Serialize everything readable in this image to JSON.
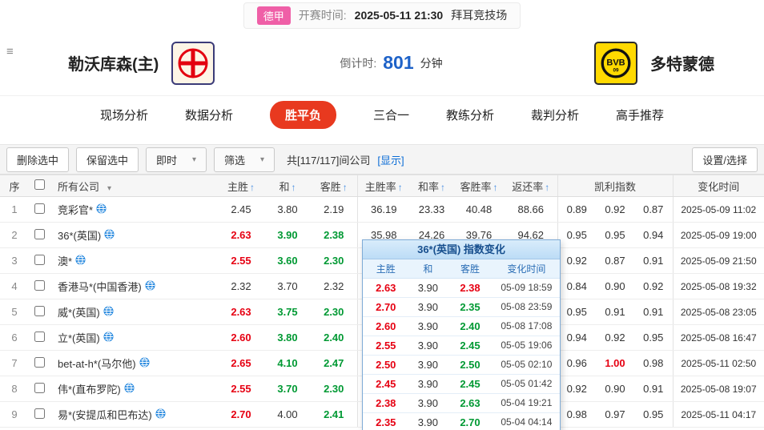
{
  "top_bar": {
    "league": "德甲",
    "kickoff_label": "开赛时间:",
    "kickoff_time": "2025-05-11 21:30",
    "venue": "拜耳竞技场"
  },
  "header": {
    "home_team": "勒沃库森(主)",
    "away_team": "多特蒙德",
    "countdown_label": "倒计时:",
    "countdown_value": "801",
    "countdown_unit": "分钟",
    "away_logo_text": "BVB",
    "away_logo_sub": "09"
  },
  "nav": {
    "tabs": [
      {
        "label": "现场分析",
        "active": false
      },
      {
        "label": "数据分析",
        "active": false
      },
      {
        "label": "胜平负",
        "active": true
      },
      {
        "label": "三合一",
        "active": false
      },
      {
        "label": "教练分析",
        "active": false
      },
      {
        "label": "裁判分析",
        "active": false
      },
      {
        "label": "高手推荐",
        "active": false
      }
    ]
  },
  "toolbar": {
    "delete_btn": "删除选中",
    "keep_btn": "保留选中",
    "instant_dropdown": "即时",
    "filter_dropdown": "筛选",
    "count_text": "共[117/117]间公司",
    "show_link": "[显示]",
    "settings_btn": "设置/选择"
  },
  "table": {
    "header": {
      "seq": "序",
      "company": "所有公司",
      "odds_cols": [
        "主胜",
        "和",
        "客胜"
      ],
      "rate_cols": [
        "主胜率",
        "和率",
        "客胜率",
        "返还率"
      ],
      "kelly": "凯利指数",
      "time": "变化时间",
      "sort_arrow": "↑"
    },
    "rows": [
      {
        "no": "1",
        "company": "竞彩官*",
        "odds": [
          [
            "2.45",
            "k"
          ],
          [
            "3.80",
            "k"
          ],
          [
            "2.19",
            "k"
          ]
        ],
        "rates": [
          "36.19",
          "23.33",
          "40.48",
          "88.66"
        ],
        "kelly": [
          [
            "0.89",
            "k"
          ],
          [
            "0.92",
            "k"
          ],
          [
            "0.87",
            "k"
          ]
        ],
        "time": "2025-05-09 11:02"
      },
      {
        "no": "2",
        "company": "36*(英国)",
        "odds": [
          [
            "2.63",
            "r"
          ],
          [
            "3.90",
            "g"
          ],
          [
            "2.38",
            "g"
          ]
        ],
        "rates": [
          "35.98",
          "24.26",
          "39.76",
          "94.62"
        ],
        "kelly": [
          [
            "0.95",
            "k"
          ],
          [
            "0.95",
            "k"
          ],
          [
            "0.94",
            "k"
          ]
        ],
        "time": "2025-05-09 19:00"
      },
      {
        "no": "3",
        "company": "澳*",
        "odds": [
          [
            "2.55",
            "r"
          ],
          [
            "3.60",
            "g"
          ],
          [
            "2.30",
            "g"
          ]
        ],
        "rates": [
          "",
          "",
          "",
          ""
        ],
        "kelly": [
          [
            "0.92",
            "k"
          ],
          [
            "0.87",
            "k"
          ],
          [
            "0.91",
            "k"
          ]
        ],
        "time": "2025-05-09 21:50"
      },
      {
        "no": "4",
        "company": "香港马*(中国香港)",
        "odds": [
          [
            "2.32",
            "k"
          ],
          [
            "3.70",
            "k"
          ],
          [
            "2.32",
            "k"
          ]
        ],
        "rates": [
          "",
          "",
          "",
          ""
        ],
        "kelly": [
          [
            "0.84",
            "k"
          ],
          [
            "0.90",
            "k"
          ],
          [
            "0.92",
            "k"
          ]
        ],
        "time": "2025-05-08 19:32"
      },
      {
        "no": "5",
        "company": "威*(英国)",
        "odds": [
          [
            "2.63",
            "r"
          ],
          [
            "3.75",
            "g"
          ],
          [
            "2.30",
            "g"
          ]
        ],
        "rates": [
          "",
          "",
          "",
          ""
        ],
        "kelly": [
          [
            "0.95",
            "k"
          ],
          [
            "0.91",
            "k"
          ],
          [
            "0.91",
            "k"
          ]
        ],
        "time": "2025-05-08 23:05"
      },
      {
        "no": "6",
        "company": "立*(英国)",
        "odds": [
          [
            "2.60",
            "r"
          ],
          [
            "3.80",
            "g"
          ],
          [
            "2.40",
            "g"
          ]
        ],
        "rates": [
          "",
          "",
          "",
          ""
        ],
        "kelly": [
          [
            "0.94",
            "k"
          ],
          [
            "0.92",
            "k"
          ],
          [
            "0.95",
            "k"
          ]
        ],
        "time": "2025-05-08 16:47"
      },
      {
        "no": "7",
        "company": "bet-at-h*(马尔他)",
        "odds": [
          [
            "2.65",
            "r"
          ],
          [
            "4.10",
            "g"
          ],
          [
            "2.47",
            "g"
          ]
        ],
        "rates": [
          "",
          "",
          "",
          ""
        ],
        "kelly": [
          [
            "0.96",
            "k"
          ],
          [
            "1.00",
            "r"
          ],
          [
            "0.98",
            "k"
          ]
        ],
        "time": "2025-05-11 02:50"
      },
      {
        "no": "8",
        "company": "伟*(直布罗陀)",
        "odds": [
          [
            "2.55",
            "r"
          ],
          [
            "3.70",
            "g"
          ],
          [
            "2.30",
            "g"
          ]
        ],
        "rates": [
          "",
          "",
          "",
          ""
        ],
        "kelly": [
          [
            "0.92",
            "k"
          ],
          [
            "0.90",
            "k"
          ],
          [
            "0.91",
            "k"
          ]
        ],
        "time": "2025-05-08 19:07"
      },
      {
        "no": "9",
        "company": "易*(安提瓜和巴布达)",
        "odds": [
          [
            "2.70",
            "r"
          ],
          [
            "4.00",
            "k"
          ],
          [
            "2.41",
            "g"
          ]
        ],
        "rates": [
          "",
          "",
          "",
          ""
        ],
        "kelly": [
          [
            "0.98",
            "k"
          ],
          [
            "0.97",
            "k"
          ],
          [
            "0.95",
            "k"
          ]
        ],
        "time": "2025-05-11 04:17"
      }
    ]
  },
  "popup": {
    "title": "36*(英国) 指数变化",
    "columns": [
      "主胜",
      "和",
      "客胜",
      "变化时间"
    ],
    "rows": [
      {
        "cells": [
          [
            "2.63",
            "r"
          ],
          [
            "3.90",
            "k"
          ],
          [
            "2.38",
            "r"
          ]
        ],
        "time": "05-09 18:59"
      },
      {
        "cells": [
          [
            "2.70",
            "r"
          ],
          [
            "3.90",
            "k"
          ],
          [
            "2.35",
            "g"
          ]
        ],
        "time": "05-08 23:59"
      },
      {
        "cells": [
          [
            "2.60",
            "r"
          ],
          [
            "3.90",
            "k"
          ],
          [
            "2.40",
            "g"
          ]
        ],
        "time": "05-08 17:08"
      },
      {
        "cells": [
          [
            "2.55",
            "r"
          ],
          [
            "3.90",
            "k"
          ],
          [
            "2.45",
            "g"
          ]
        ],
        "time": "05-05 19:06"
      },
      {
        "cells": [
          [
            "2.50",
            "r"
          ],
          [
            "3.90",
            "k"
          ],
          [
            "2.50",
            "g"
          ]
        ],
        "time": "05-05 02:10"
      },
      {
        "cells": [
          [
            "2.45",
            "r"
          ],
          [
            "3.90",
            "k"
          ],
          [
            "2.45",
            "g"
          ]
        ],
        "time": "05-05 01:42"
      },
      {
        "cells": [
          [
            "2.38",
            "r"
          ],
          [
            "3.90",
            "k"
          ],
          [
            "2.63",
            "g"
          ]
        ],
        "time": "05-04 19:21"
      },
      {
        "cells": [
          [
            "2.35",
            "r"
          ],
          [
            "3.90",
            "k"
          ],
          [
            "2.70",
            "g"
          ]
        ],
        "time": "05-04 04:14"
      }
    ]
  },
  "colors": {
    "odds_up": "#e60012",
    "odds_down": "#009933",
    "active_tab": "#e8391f",
    "countdown_blue": "#1e62c8",
    "link_blue": "#0a6cd6",
    "league_badge_pink": "#ef5fa7"
  }
}
